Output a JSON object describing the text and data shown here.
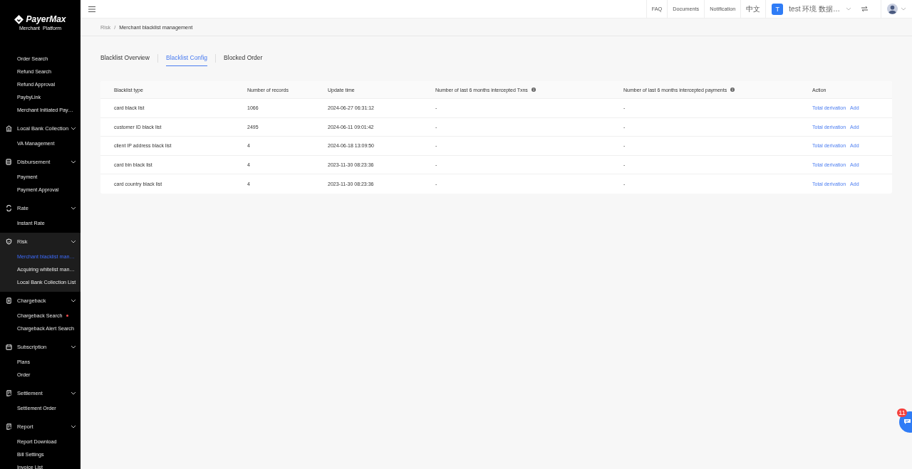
{
  "sidebar": {
    "logo": {
      "name": "PayerMax",
      "subtitle": [
        "Merchant",
        "Platform"
      ]
    },
    "groups": [
      {
        "items": [
          {
            "label": "Order Search",
            "selected": false
          },
          {
            "label": "Refund Search",
            "selected": false
          },
          {
            "label": "Refund Approval",
            "selected": false
          },
          {
            "label": "PaybyLink",
            "selected": false
          },
          {
            "label": "Merchant Initiated Pay…",
            "selected": false
          }
        ]
      },
      {
        "title": "Local Bank Collection",
        "kind": "bank",
        "expanded": true,
        "selected": false,
        "items": [
          {
            "label": "VA Management",
            "selected": false
          }
        ]
      },
      {
        "title": "Disbursement",
        "kind": "disbursement",
        "expanded": true,
        "selected": false,
        "items": [
          {
            "label": "Payment",
            "selected": false
          },
          {
            "label": "Payment Approval",
            "selected": false
          }
        ]
      },
      {
        "title": "Rate",
        "kind": "rate",
        "expanded": true,
        "selected": false,
        "items": [
          {
            "label": "Instant Rate",
            "selected": false
          }
        ]
      },
      {
        "title": "Risk",
        "kind": "risk",
        "expanded": true,
        "selected": true,
        "items": [
          {
            "label": "Merchant blacklist man…",
            "selected": true
          },
          {
            "label": "Acquiring whitelist man…",
            "selected": false
          },
          {
            "label": "Local Bank Collection List",
            "selected": false
          }
        ]
      },
      {
        "title": "Chargeback",
        "kind": "chargeback",
        "expanded": true,
        "selected": false,
        "items": [
          {
            "label": "Chargeback Search",
            "selected": false,
            "dot": true
          },
          {
            "label": "Chargeback Alert Search",
            "selected": false
          }
        ]
      },
      {
        "title": "Subscription",
        "kind": "subscription",
        "expanded": true,
        "selected": false,
        "items": [
          {
            "label": "Plans",
            "selected": false
          },
          {
            "label": "Order",
            "selected": false
          }
        ]
      },
      {
        "title": "Settlement",
        "kind": "settlement",
        "expanded": true,
        "selected": false,
        "items": [
          {
            "label": "Settlement Order",
            "selected": false
          }
        ]
      },
      {
        "title": "Report",
        "kind": "report",
        "expanded": true,
        "selected": false,
        "items": [
          {
            "label": "Report Download",
            "selected": false
          },
          {
            "label": "Bill Settings",
            "selected": false
          },
          {
            "label": "Invoice List",
            "selected": false
          }
        ]
      }
    ]
  },
  "topbar": {
    "links": [
      "FAQ",
      "Documents",
      "Notification",
      "中文"
    ],
    "account": {
      "initial": "T",
      "name": "test 环境 数据…"
    }
  },
  "breadcrumb": {
    "items": [
      "Risk",
      "Merchant blacklist management"
    ],
    "separator": "/"
  },
  "tabs": [
    {
      "label": "Blacklist Overview",
      "selected": false
    },
    {
      "label": "Blacklist Config",
      "selected": true
    },
    {
      "label": "Blocked Order",
      "selected": false
    }
  ],
  "table": {
    "columns": [
      {
        "label": "Blacklist type"
      },
      {
        "label": "Number of records"
      },
      {
        "label": "Update time"
      },
      {
        "label": "Number of last 6 months intercepted Txns",
        "info": true
      },
      {
        "label": "Number of last 6 months intercepted payments",
        "info": true
      },
      {
        "label": "Action"
      }
    ],
    "rows": [
      {
        "cells": [
          "card black list",
          "1066",
          "2024-06-27 06:31:12",
          "-",
          "-"
        ],
        "actions": [
          "Total derivation",
          "Add"
        ]
      },
      {
        "cells": [
          "customer ID black list",
          "2495",
          "2024-06-11 09:01:42",
          "-",
          "-"
        ],
        "actions": [
          "Total derivation",
          "Add"
        ]
      },
      {
        "cells": [
          "client IP address black list",
          "4",
          "2024-06-18 13:09:50",
          "-",
          "-"
        ],
        "actions": [
          "Total derivation",
          "Add"
        ]
      },
      {
        "cells": [
          "card bin black list",
          "4",
          "2023-11-30 08:23:36",
          "-",
          "-"
        ],
        "actions": [
          "Total derivation",
          "Add"
        ]
      },
      {
        "cells": [
          "card country black list",
          "4",
          "2023-11-30 08:23:36",
          "-",
          "-"
        ],
        "actions": [
          "Total derivation",
          "Add"
        ]
      }
    ]
  },
  "chat": {
    "badge": "11"
  }
}
